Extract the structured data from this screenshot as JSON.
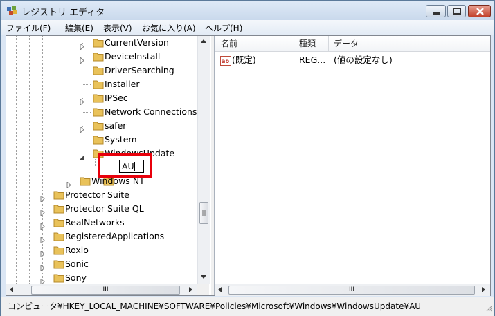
{
  "window": {
    "title": "レジストリ エディタ"
  },
  "menu": [
    {
      "label": "ファイル(F)"
    },
    {
      "label": "編集(E)"
    },
    {
      "label": "表示(V)"
    },
    {
      "label": "お気に入り(A)"
    },
    {
      "label": "ヘルプ(H)"
    }
  ],
  "tree": {
    "windows_items": [
      {
        "label": "CurrentVersion",
        "expandable": true
      },
      {
        "label": "DeviceInstall",
        "expandable": true
      },
      {
        "label": "DriverSearching",
        "expandable": false
      },
      {
        "label": "Installer",
        "expandable": false
      },
      {
        "label": "IPSec",
        "expandable": true
      },
      {
        "label": "Network Connections",
        "expandable": false
      },
      {
        "label": "safer",
        "expandable": true
      },
      {
        "label": "System",
        "expandable": false
      },
      {
        "label": "WindowsUpdate",
        "expandable": true,
        "expanded": true
      }
    ],
    "editing_key": {
      "value": "AU"
    },
    "windows_nt": {
      "label": "Windows NT"
    },
    "policy_items": [
      {
        "label": "Protector Suite"
      },
      {
        "label": "Protector Suite QL"
      },
      {
        "label": "RealNetworks"
      },
      {
        "label": "RegisteredApplications"
      },
      {
        "label": "Roxio"
      },
      {
        "label": "Sonic"
      },
      {
        "label": "Sony"
      }
    ]
  },
  "list": {
    "columns": [
      "名前",
      "種類",
      "データ"
    ],
    "rows": [
      {
        "name": "(既定)",
        "type": "REG...",
        "data": "(値の設定なし)",
        "icon": "string-value-icon"
      }
    ]
  },
  "scroll": {
    "grip_glyph": "III"
  },
  "statusbar": {
    "path": "コンピュータ¥HKEY_LOCAL_MACHINE¥SOFTWARE¥Policies¥Microsoft¥Windows¥WindowsUpdate¥AU"
  },
  "colors": {
    "highlight": "#e8000b",
    "folder": "#e9c25a",
    "title_bar": "#c9d9ec"
  }
}
